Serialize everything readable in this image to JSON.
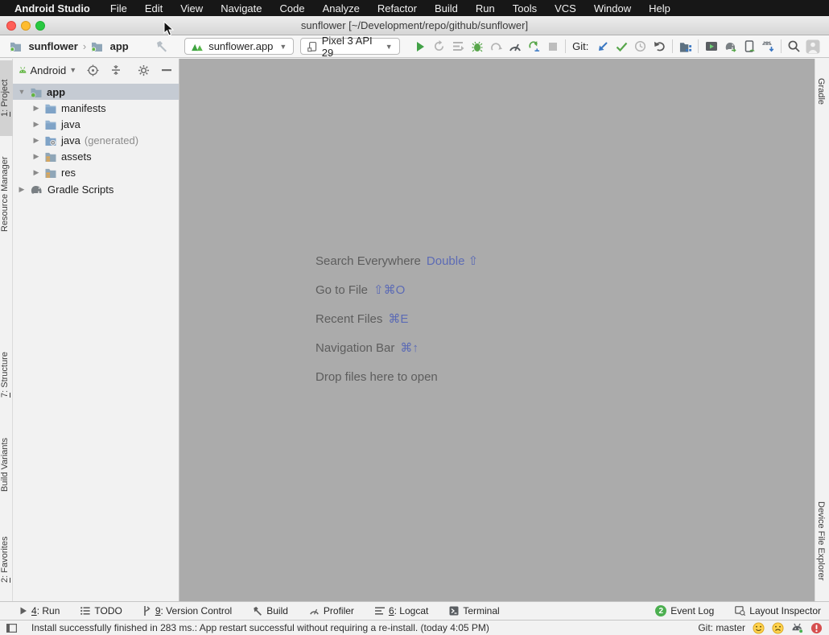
{
  "menu_bar": {
    "app_name": "Android Studio",
    "items": [
      "File",
      "Edit",
      "View",
      "Navigate",
      "Code",
      "Analyze",
      "Refactor",
      "Build",
      "Run",
      "Tools",
      "VCS",
      "Window",
      "Help"
    ]
  },
  "title_bar": {
    "title": "sunflower [~/Development/repo/github/sunflower]"
  },
  "toolbar": {
    "breadcrumb_project": "sunflower",
    "breadcrumb_module": "app",
    "run_config": "sunflower.app",
    "device": "Pixel 3 API 29",
    "git_label": "Git:"
  },
  "project_panel": {
    "view_selector": "Android",
    "tree": [
      {
        "label": "app"
      },
      {
        "label": "manifests"
      },
      {
        "label": "java"
      },
      {
        "label": "java",
        "suffix": "(generated)"
      },
      {
        "label": "assets"
      },
      {
        "label": "res"
      },
      {
        "label": "Gradle Scripts"
      }
    ]
  },
  "editor": {
    "shortcuts": [
      {
        "label": "Search Everywhere",
        "keys": "Double ⇧"
      },
      {
        "label": "Go to File",
        "keys": "⇧⌘O"
      },
      {
        "label": "Recent Files",
        "keys": "⌘E"
      },
      {
        "label": "Navigation Bar",
        "keys": "⌘↑"
      }
    ],
    "drop_hint": "Drop files here to open"
  },
  "left_stripe": [
    {
      "num": "1",
      "rest": ": Project"
    },
    {
      "num": "",
      "rest": "Resource Manager"
    },
    {
      "num": "7",
      "rest": ": Structure"
    },
    {
      "num": "",
      "rest": "Build Variants"
    },
    {
      "num": "2",
      "rest": ": Favorites"
    }
  ],
  "right_stripe": [
    {
      "label": "Gradle"
    },
    {
      "label": "Device File Explorer"
    }
  ],
  "bottom_bar": {
    "left": [
      {
        "num": "4",
        "rest": ": Run"
      },
      {
        "num": "",
        "rest": "TODO"
      },
      {
        "num": "9",
        "rest": ": Version Control"
      },
      {
        "num": "",
        "rest": "Build"
      },
      {
        "num": "",
        "rest": "Profiler"
      },
      {
        "num": "6",
        "rest": ": Logcat"
      },
      {
        "num": "",
        "rest": "Terminal"
      }
    ],
    "event_log": {
      "badge": "2",
      "label": "Event Log"
    },
    "layout_inspector": "Layout Inspector"
  },
  "status_bar": {
    "message": "Install successfully finished in 283 ms.: App restart successful without requiring a re-install. (today 4:05 PM)",
    "git_branch": "Git: master"
  },
  "colors": {
    "accent_green": "#4caf50",
    "shortcut_blue": "#5c6bb5",
    "editor_bg": "#ababab",
    "selection_gray": "#c5cbd3"
  }
}
